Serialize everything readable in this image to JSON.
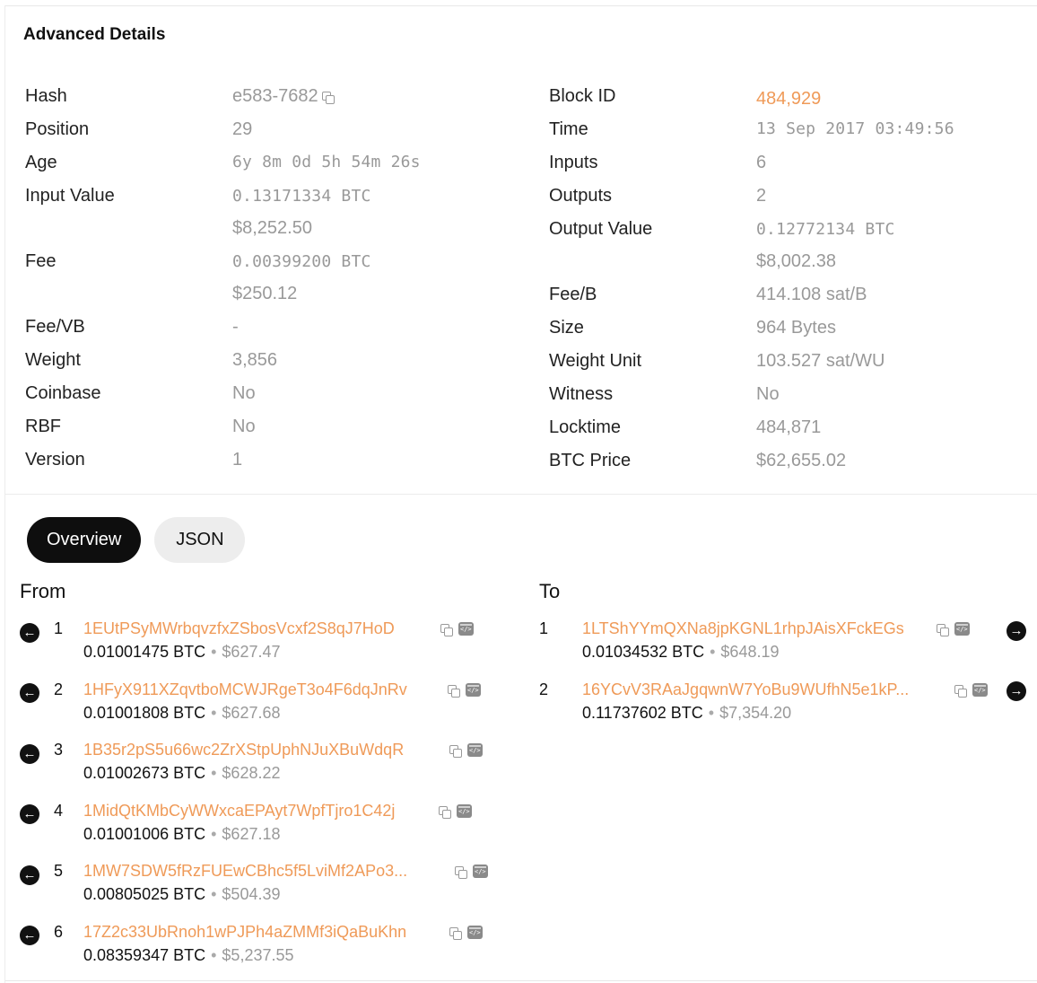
{
  "section_title": "Advanced Details",
  "details_left": [
    {
      "label": "Hash",
      "value": "e583-7682",
      "has_copy": true
    },
    {
      "label": "Position",
      "value": "29"
    },
    {
      "label": "Age",
      "value": "6y 8m 0d 5h 54m 26s"
    },
    {
      "label": "Input Value",
      "value": "0.13171334 BTC",
      "sub": "$8,252.50"
    },
    {
      "label": "Fee",
      "value": "0.00399200 BTC",
      "sub": "$250.12"
    },
    {
      "label": "Fee/VB",
      "value": "-"
    },
    {
      "label": "Weight",
      "value": "3,856"
    },
    {
      "label": "Coinbase",
      "value": "No"
    },
    {
      "label": "RBF",
      "value": "No"
    },
    {
      "label": "Version",
      "value": "1"
    }
  ],
  "details_right": [
    {
      "label": "Block ID",
      "value": "484,929",
      "link": true
    },
    {
      "label": "Time",
      "value": "13 Sep 2017 03:49:56"
    },
    {
      "label": "Inputs",
      "value": "6"
    },
    {
      "label": "Outputs",
      "value": "2"
    },
    {
      "label": "Output Value",
      "value": "0.12772134 BTC",
      "sub": "$8,002.38"
    },
    {
      "label": "Fee/B",
      "value": "414.108 sat/B"
    },
    {
      "label": "Size",
      "value": "964 Bytes"
    },
    {
      "label": "Weight Unit",
      "value": "103.527 sat/WU"
    },
    {
      "label": "Witness",
      "value": "No"
    },
    {
      "label": "Locktime",
      "value": "484,871"
    },
    {
      "label": "BTC Price",
      "value": "$62,655.02"
    }
  ],
  "tabs": [
    {
      "label": "Overview",
      "active": true
    },
    {
      "label": "JSON",
      "active": false
    }
  ],
  "from_title": "From",
  "to_title": "To",
  "inputs": [
    {
      "index": "1",
      "address": "1EUtPSyMWrbqvzfxZSbosVcxf2S8qJ7HoD",
      "btc": "0.01001475 BTC",
      "usd": "$627.47"
    },
    {
      "index": "2",
      "address": "1HFyX911XZqvtboMCWJRgeT3o4F6dqJnRv",
      "btc": "0.01001808 BTC",
      "usd": "$627.68"
    },
    {
      "index": "3",
      "address": "1B35r2pS5u66wc2ZrXStpUphNJuXBuWdqR",
      "btc": "0.01002673 BTC",
      "usd": "$628.22"
    },
    {
      "index": "4",
      "address": "1MidQtKMbCyWWxcaEPAyt7WpfTjro1C42j",
      "btc": "0.01001006 BTC",
      "usd": "$627.18"
    },
    {
      "index": "5",
      "address": "1MW7SDW5fRzFUEwCBhc5f5LviMf2APo3...",
      "btc": "0.00805025 BTC",
      "usd": "$504.39"
    },
    {
      "index": "6",
      "address": "17Z2c33UbRnoh1wPJPh4aZMMf3iQaBuKhn",
      "btc": "0.08359347 BTC",
      "usd": "$5,237.55"
    }
  ],
  "outputs": [
    {
      "index": "1",
      "address": "1LTShYYmQXNa8jpKGNL1rhpJAisXFckEGs",
      "btc": "0.01034532 BTC",
      "usd": "$648.19"
    },
    {
      "index": "2",
      "address": "16YCvV3RAaJgqwnW7YoBu9WUfhN5e1kP...",
      "btc": "0.11737602 BTC",
      "usd": "$7,354.20"
    }
  ],
  "colors": {
    "accent": "#ef9a58",
    "muted": "#999999",
    "active_tab": "#0e0e0e"
  }
}
